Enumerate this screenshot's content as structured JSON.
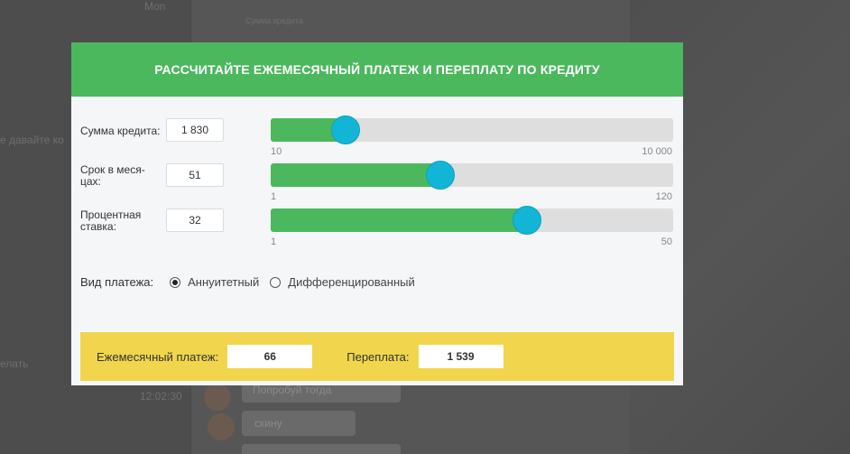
{
  "modal": {
    "title": "РАССЧИТАЙТЕ ЕЖЕМЕСЯЧНЫЙ ПЛАТЕЖ И ПЕРЕПЛАТУ ПО КРЕДИТУ"
  },
  "sliders": [
    {
      "label": "Сумма кредита:",
      "value": "1 830",
      "min_label": "10",
      "max_label": "10 000",
      "fill_fraction": 0.183
    },
    {
      "label": "Срок в меся-\nцах:",
      "value": "51",
      "min_label": "1",
      "max_label": "120",
      "fill_fraction": 0.42
    },
    {
      "label": "Процентная\nставка:",
      "value": "32",
      "min_label": "1",
      "max_label": "50",
      "fill_fraction": 0.63
    }
  ],
  "payment_type": {
    "label": "Вид платежа:",
    "options": [
      "Аннуитетный",
      "Дифференцированный"
    ],
    "selected": "Аннуитетный"
  },
  "result": {
    "monthly_label": "Ежемесячный платеж:",
    "monthly_value": "66",
    "overpay_label": "Переплата:",
    "overpay_value": "1 539"
  },
  "background": {
    "snippets": [
      "Mon",
      "Сумма кредита",
      "e давайте ко",
      "елать",
      "Попробуй тогда",
      "скину",
      "12:02:30"
    ]
  },
  "colors": {
    "header_green": "#4cb85e",
    "knob_blue": "#12b5d6",
    "result_yellow": "#f0d54d"
  }
}
